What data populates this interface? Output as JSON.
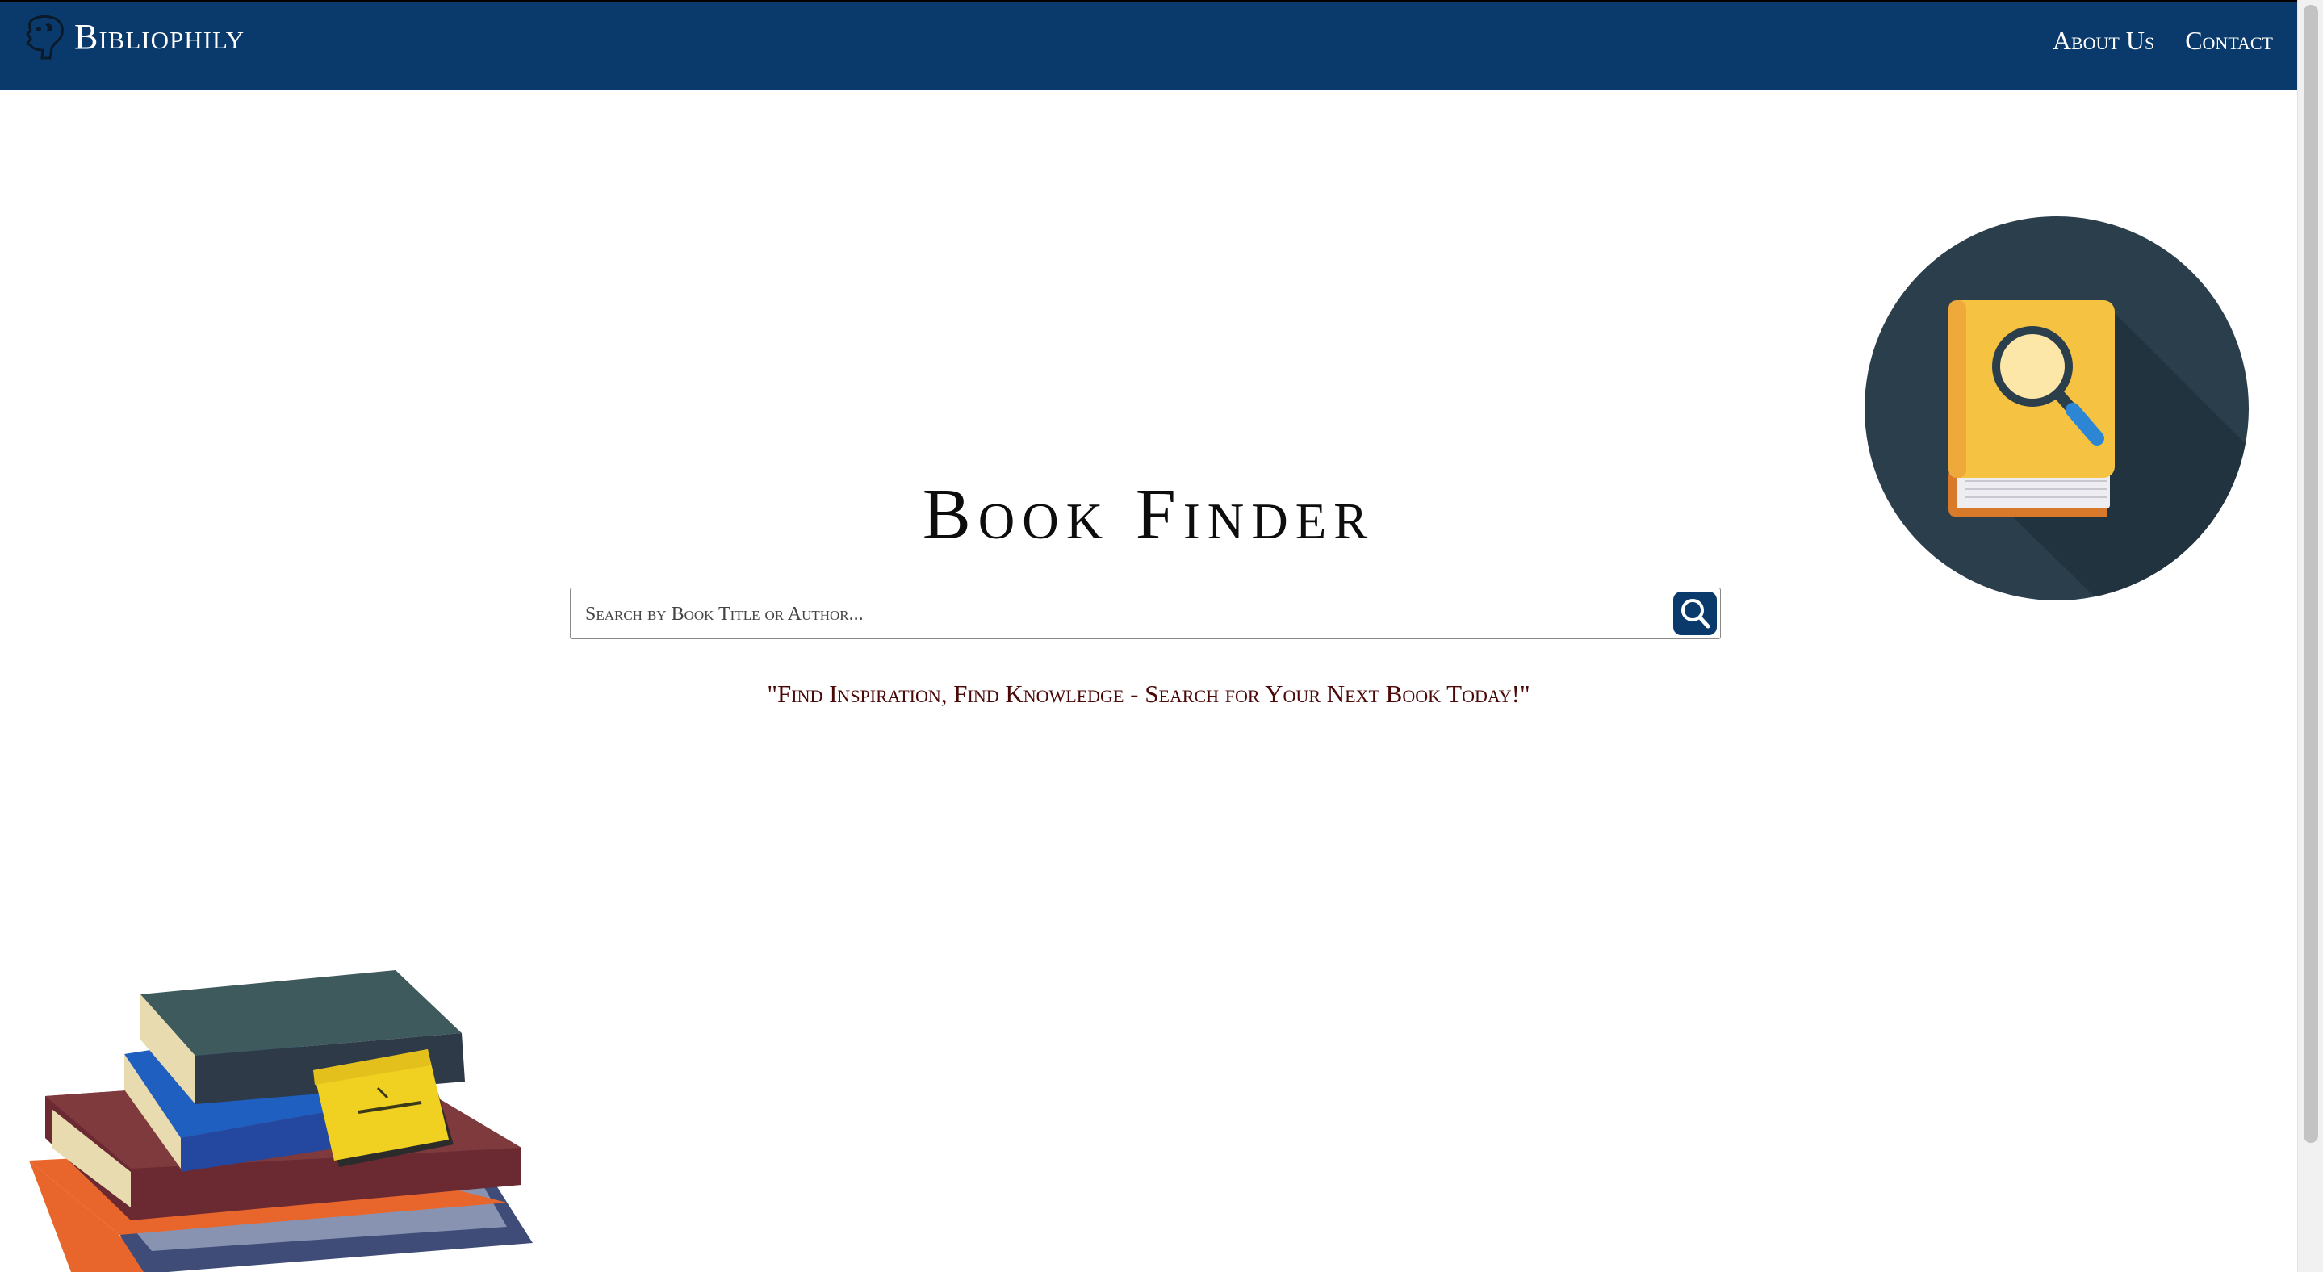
{
  "navbar": {
    "brand": "Bibliophily",
    "links": [
      "About Us",
      "Contact"
    ],
    "background_color": "#0a3a6b"
  },
  "main": {
    "title": "Book Finder",
    "search": {
      "placeholder": "Search by Book Title or Author...",
      "value": "",
      "button_icon": "search-icon"
    },
    "tagline": "\"Find Inspiration, Find Knowledge - Search for Your Next Book Today!\""
  },
  "illustrations": [
    "book-with-magnifier-illustration",
    "book-stack-illustration"
  ],
  "colors": {
    "nav_bg": "#0a3a6b",
    "tagline": "#4b0808",
    "title": "#0d0d0d"
  }
}
